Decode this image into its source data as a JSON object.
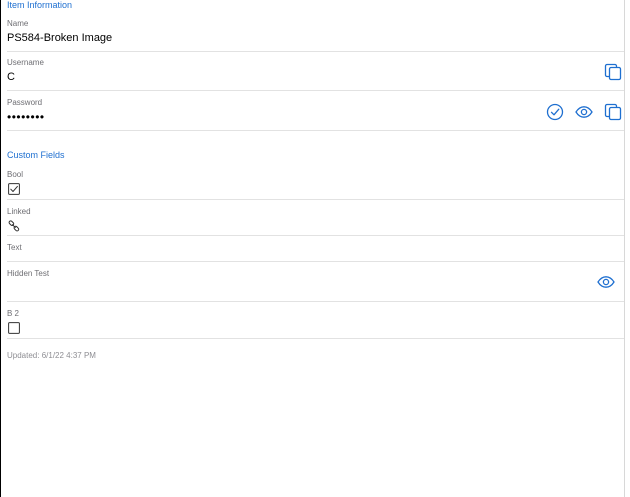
{
  "item_information": {
    "header": "Item Information",
    "name": {
      "label": "Name",
      "value": "PS584-Broken Image"
    },
    "username": {
      "label": "Username",
      "value": "C"
    },
    "password": {
      "label": "Password",
      "value": "••••••••"
    }
  },
  "custom_fields": {
    "header": "Custom Fields",
    "bool": {
      "label": "Bool",
      "checked": true
    },
    "linked": {
      "label": "Linked",
      "icon": "link-icon"
    },
    "text": {
      "label": "Text"
    },
    "hidden_test": {
      "label": "Hidden Test"
    },
    "b2": {
      "label": "B 2",
      "checked": false
    }
  },
  "footer": {
    "updated": "Updated: 6/1/22 4:37 PM"
  },
  "colors": {
    "accent": "#1e6fd0",
    "label": "#6e6e73",
    "divider": "#e2e2e2"
  }
}
